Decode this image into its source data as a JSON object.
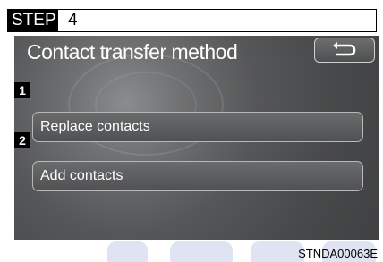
{
  "step": {
    "label": "STEP",
    "number": "4"
  },
  "screen": {
    "title": "Contact transfer method",
    "back_icon": "return-arrow-icon",
    "options": [
      {
        "number": "1",
        "label": "Replace contacts"
      },
      {
        "number": "2",
        "label": "Add contacts"
      }
    ]
  },
  "figure_code": "STNDA00063E",
  "colors": {
    "screen_bg": "#474849",
    "button_border": "#b8b8b8",
    "text": "#ffffff"
  }
}
